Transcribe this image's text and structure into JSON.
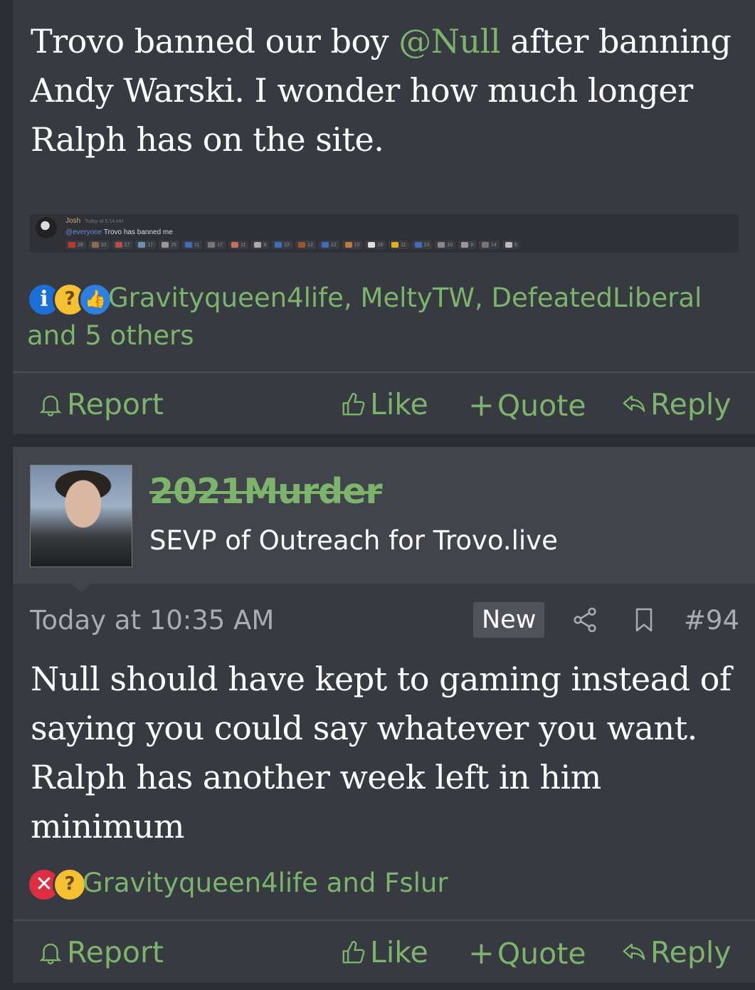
{
  "posts": [
    {
      "body": [
        "Trovo banned our boy ",
        "@Null",
        " after banning Andy Warski. I wonder how much longer Ralph has on the site."
      ],
      "embed": {
        "author": "Josh",
        "timestamp": "Today at 5:14 AM",
        "mention": "@everyone",
        "message": "Trovo has banned me",
        "reaction_counts": [
          "28",
          "32",
          "27",
          "17",
          "25",
          "11",
          "17",
          "11",
          "9",
          "22",
          "12",
          "12",
          "10",
          "16",
          "11",
          "13",
          "10",
          "9",
          "14",
          "5"
        ]
      },
      "reactions": {
        "icons": [
          "info-icon",
          "thinking-face-icon",
          "thumbs-up-icon"
        ],
        "text": "Gravityqueen4life, MeltyTW, DefeatedLiberal and 5 others"
      },
      "actions": {
        "report": "Report",
        "like": "Like",
        "quote": "Quote",
        "reply": "Reply"
      }
    },
    {
      "user": {
        "name": "2021Murder",
        "title": "SEVP of Outreach for Trovo.live"
      },
      "meta": {
        "time": "Today at 10:35 AM",
        "badge": "New",
        "post_number": "#94"
      },
      "body": "Null should have kept to gaming instead of saying you could say whatever you want. Ralph has another week left in him minimum",
      "reactions": {
        "icons": [
          "x-mark-icon",
          "thinking-face-icon"
        ],
        "text": "Gravityqueen4life and Fslur"
      },
      "actions": {
        "report": "Report",
        "like": "Like",
        "quote": "Quote",
        "reply": "Reply"
      }
    }
  ],
  "colors": {
    "accent": "#7db46c",
    "background": "#2a2d33",
    "post": "#373a41",
    "user_block": "#41444b"
  }
}
